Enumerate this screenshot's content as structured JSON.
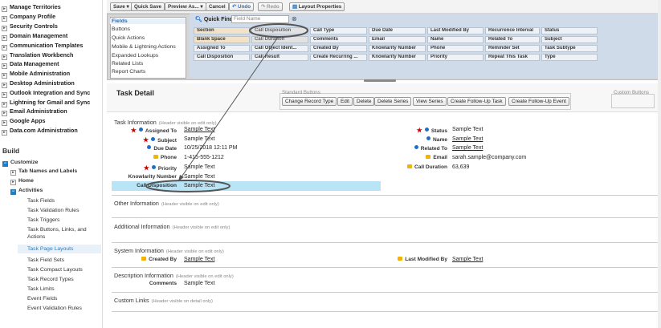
{
  "sidebar": {
    "nav_items": [
      {
        "label": "Manage Territories",
        "icon": "plus-icon"
      },
      {
        "label": "Company Profile",
        "icon": "plus-icon"
      },
      {
        "label": "Security Controls",
        "icon": "plus-icon"
      },
      {
        "label": "Domain Management",
        "icon": "plus-icon"
      },
      {
        "label": "Communication Templates",
        "icon": "plus-icon"
      },
      {
        "label": "Translation Workbench",
        "icon": "plus-icon"
      },
      {
        "label": "Data Management",
        "icon": "plus-icon"
      },
      {
        "label": "Mobile Administration",
        "icon": "plus-icon"
      },
      {
        "label": "Desktop Administration",
        "icon": "plus-icon"
      },
      {
        "label": "Outlook Integration and Sync",
        "icon": "plus-icon"
      },
      {
        "label": "Lightning for Gmail and Sync",
        "icon": "plus-icon"
      },
      {
        "label": "Email Administration",
        "icon": "plus-icon"
      },
      {
        "label": "Google Apps",
        "icon": "plus-icon"
      },
      {
        "label": "Data.com Administration",
        "icon": "plus-icon"
      }
    ],
    "build_title": "Build",
    "customize": "Customize",
    "tab_names": "Tab Names and Labels",
    "home": "Home",
    "activities": "Activities",
    "activities_items": [
      "Task Fields",
      "Task Validation Rules",
      "Task Triggers",
      "Task Buttons, Links, and",
      "Actions",
      "Task Page Layouts",
      "Task Field Sets",
      "Task Compact Layouts",
      "Task Record Types",
      "Task Limits",
      "Event Fields",
      "Event Validation Rules"
    ]
  },
  "toolbar": {
    "save": "Save ▾",
    "quick_save": "Quick Save",
    "preview_as": "Preview As... ▾",
    "cancel": "Cancel",
    "undo": "Undo",
    "redo": "Redo",
    "layout_properties": "Layout Properties"
  },
  "palette": {
    "categories": [
      "Fields",
      "Buttons",
      "Quick Actions",
      "Mobile & Lightning Actions",
      "Expanded Lookups",
      "Related Lists",
      "Report Charts"
    ],
    "quick_find_label": "Quick Find",
    "quick_find_placeholder": "Field Name",
    "rows": [
      [
        "Section",
        "Call Disposition",
        "Call Type",
        "Due Date",
        "Last Modified By",
        "Recurrence Interval",
        "Status"
      ],
      [
        "Blank Space",
        "Call Duration",
        "Comments",
        "Email",
        "Name",
        "Related To",
        "Subject"
      ],
      [
        "Assigned To",
        "Call Object Ident...",
        "Created By",
        "Knowlarity Number",
        "Phone",
        "Reminder Set",
        "Task Subtype"
      ],
      [
        "Call Disposition",
        "Call Result",
        "Create Recurring ...",
        "Knowlarity Number",
        "Priority",
        "Repeat This Task",
        "Type"
      ]
    ]
  },
  "detail": {
    "title": "Task Detail",
    "standard_buttons_label": "Standard Buttons",
    "custom_buttons_label": "Custom Buttons",
    "buttons": [
      "Change Record Type",
      "Edit",
      "Delete",
      "Delete Series",
      "View Series",
      "Create Follow-Up Task",
      "Create Follow-Up Event"
    ],
    "task_info_title": "Task Information",
    "task_info_hint": "(Header visible on edit only)",
    "left_fields": [
      {
        "label": "Assigned To",
        "value": "Sample Text"
      },
      {
        "label": "Subject",
        "value": "Sample Text"
      },
      {
        "label": "Due Date",
        "value": "10/25/2018 12:11 PM"
      },
      {
        "label": "Phone",
        "value": "1-415-555-1212"
      },
      {
        "label": "Priority",
        "value": "Sample Text"
      },
      {
        "label": "Knowlarity Number",
        "value": "Sample Text"
      },
      {
        "label": "Call Disposition",
        "value": "Sample Text"
      }
    ],
    "right_fields": [
      {
        "label": "Status",
        "value": "Sample Text"
      },
      {
        "label": "Name",
        "value": "Sample Text"
      },
      {
        "label": "Related To",
        "value": "Sample Text"
      },
      {
        "label": "Email",
        "value": "sarah.sample@company.com"
      },
      {
        "label": "Call Duration",
        "value": "63,639"
      }
    ],
    "other_info_title": "Other Information",
    "other_info_hint": "(Header visible on edit only)",
    "additional_info_title": "Additional Information",
    "additional_info_hint": "(Header visible on edit only)",
    "system_info_title": "System Information",
    "system_info_hint": "(Header visible on edit only)",
    "created_by_label": "Created By",
    "created_by_value": "Sample Text",
    "last_modified_label": "Last Modified By",
    "last_modified_value": "Sample Text",
    "description_title": "Description Information",
    "description_hint": "(Header visible on edit only)",
    "comments_label": "Comments",
    "comments_value": "Sample Text",
    "custom_links_title": "Custom Links",
    "custom_links_hint": "(Header visible on detail only)"
  }
}
